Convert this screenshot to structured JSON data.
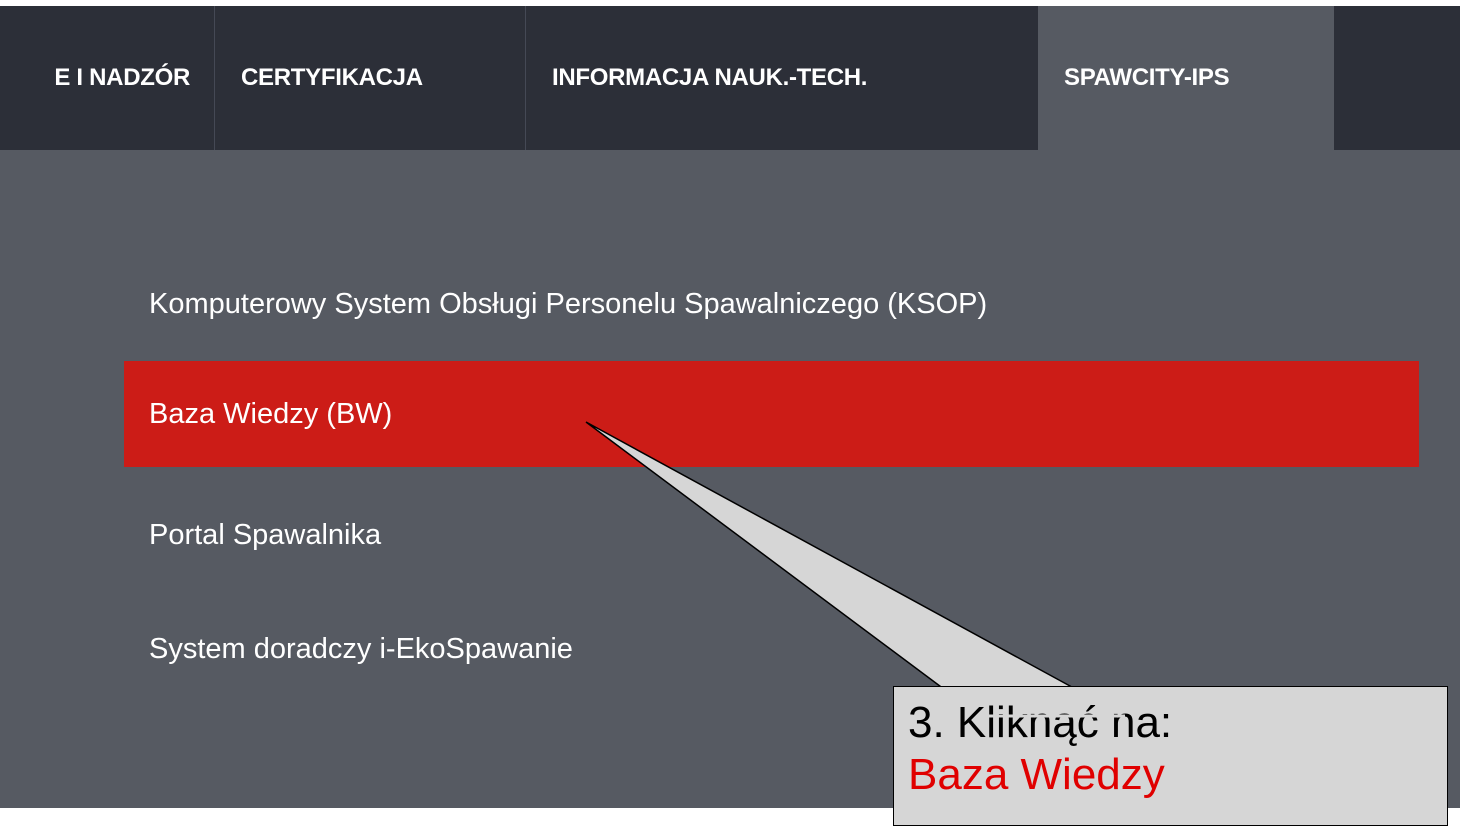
{
  "nav": {
    "tabs": [
      {
        "label": "E I NADZÓR"
      },
      {
        "label": "CERTYFIKACJA"
      },
      {
        "label": "INFORMACJA NAUK.-TECH."
      },
      {
        "label": "SPAWCITY-IPS"
      }
    ],
    "active_tab": "SPAWCITY-IPS"
  },
  "dropdown": {
    "items": [
      {
        "label": "Komputerowy System Obsługi Personelu Spawalniczego (KSOP)"
      },
      {
        "label": "Baza Wiedzy (BW)"
      },
      {
        "label": "Portal Spawalnika"
      },
      {
        "label": "System doradczy i-EkoSpawanie"
      }
    ],
    "highlighted_item": "Baza Wiedzy (BW)"
  },
  "callout": {
    "line1": "3. Kliknąć na:",
    "line2": "Baza Wiedzy"
  },
  "colors": {
    "nav_bg": "#2c2f38",
    "panel_bg": "#565a62",
    "highlight": "#cc1c17",
    "callout_bg": "#d6d6d6",
    "callout_accent": "#e00000"
  }
}
